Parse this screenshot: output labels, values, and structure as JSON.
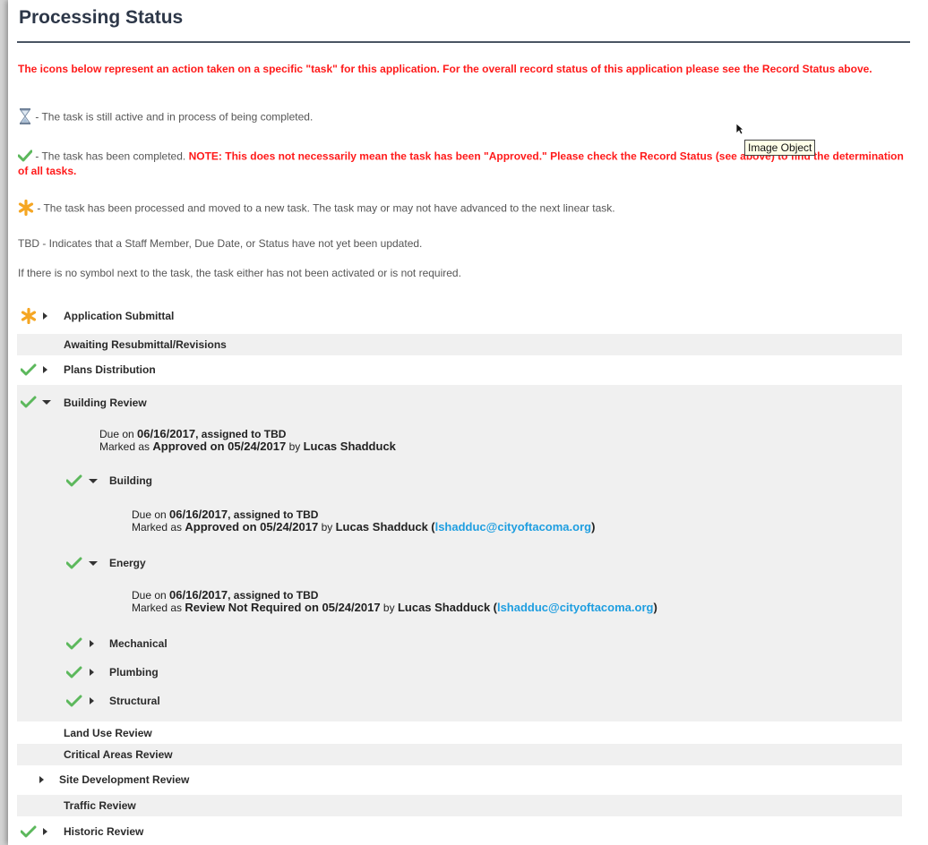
{
  "page": {
    "title": "Processing Status",
    "intro_text": "The icons below represent an action taken on a specific \"task\" for this application. For the overall record status of this application please see the Record Status above."
  },
  "legend": {
    "active_text": "- The task is still active and in process of being completed.",
    "completed_text": "- The task has been completed.",
    "completed_note": "NOTE: This does not necessarily mean the task has been \"Approved.\" Please check the Record Status (see above) to find the determination of all tasks.",
    "processed_text": "- The task has been processed and moved to a new task. The task may or may not have advanced to the next linear task.",
    "tbd_text": "TBD - Indicates that a Staff Member, Due Date, or Status have not yet been updated.",
    "no_symbol_text": "If there is no symbol next to the task, the task either has not been activated or is not required."
  },
  "tooltip": {
    "text": "Image Object"
  },
  "tasks": {
    "application_submittal": "Application Submittal",
    "awaiting_resubmittal": "Awaiting Resubmittal/Revisions",
    "plans_distribution": "Plans Distribution",
    "building_review": {
      "label": "Building Review",
      "due_prefix": "Due on",
      "due_date": "06/16/2017",
      "assigned": ", assigned to TBD",
      "marked_prefix": "Marked as",
      "status": "Approved on 05/24/2017",
      "by": "by",
      "person": "Lucas Shadduck"
    },
    "building": {
      "label": "Building",
      "due_prefix": "Due on",
      "due_date": "06/16/2017",
      "assigned": ", assigned to TBD",
      "marked_prefix": "Marked as",
      "status": "Approved on 05/24/2017",
      "by": "by",
      "person": "Lucas Shadduck",
      "email": "lshadduc@cityoftacoma.org"
    },
    "energy": {
      "label": "Energy",
      "due_prefix": "Due on",
      "due_date": "06/16/2017",
      "assigned": ", assigned to TBD",
      "marked_prefix": "Marked as",
      "status": "Review Not Required on 05/24/2017",
      "by": "by",
      "person": "Lucas Shadduck",
      "email": "lshadduc@cityoftacoma.org"
    },
    "mechanical": "Mechanical",
    "plumbing": "Plumbing",
    "structural": "Structural",
    "land_use_review": "Land Use Review",
    "critical_areas_review": "Critical Areas Review",
    "site_development_review": "Site Development Review",
    "traffic_review": "Traffic Review",
    "historic_review": "Historic Review"
  },
  "colors": {
    "accent_red": "#ff1a1a",
    "check_green": "#5cb85c",
    "asterisk_orange": "#f5a623",
    "link_blue": "#1e9ee0"
  }
}
